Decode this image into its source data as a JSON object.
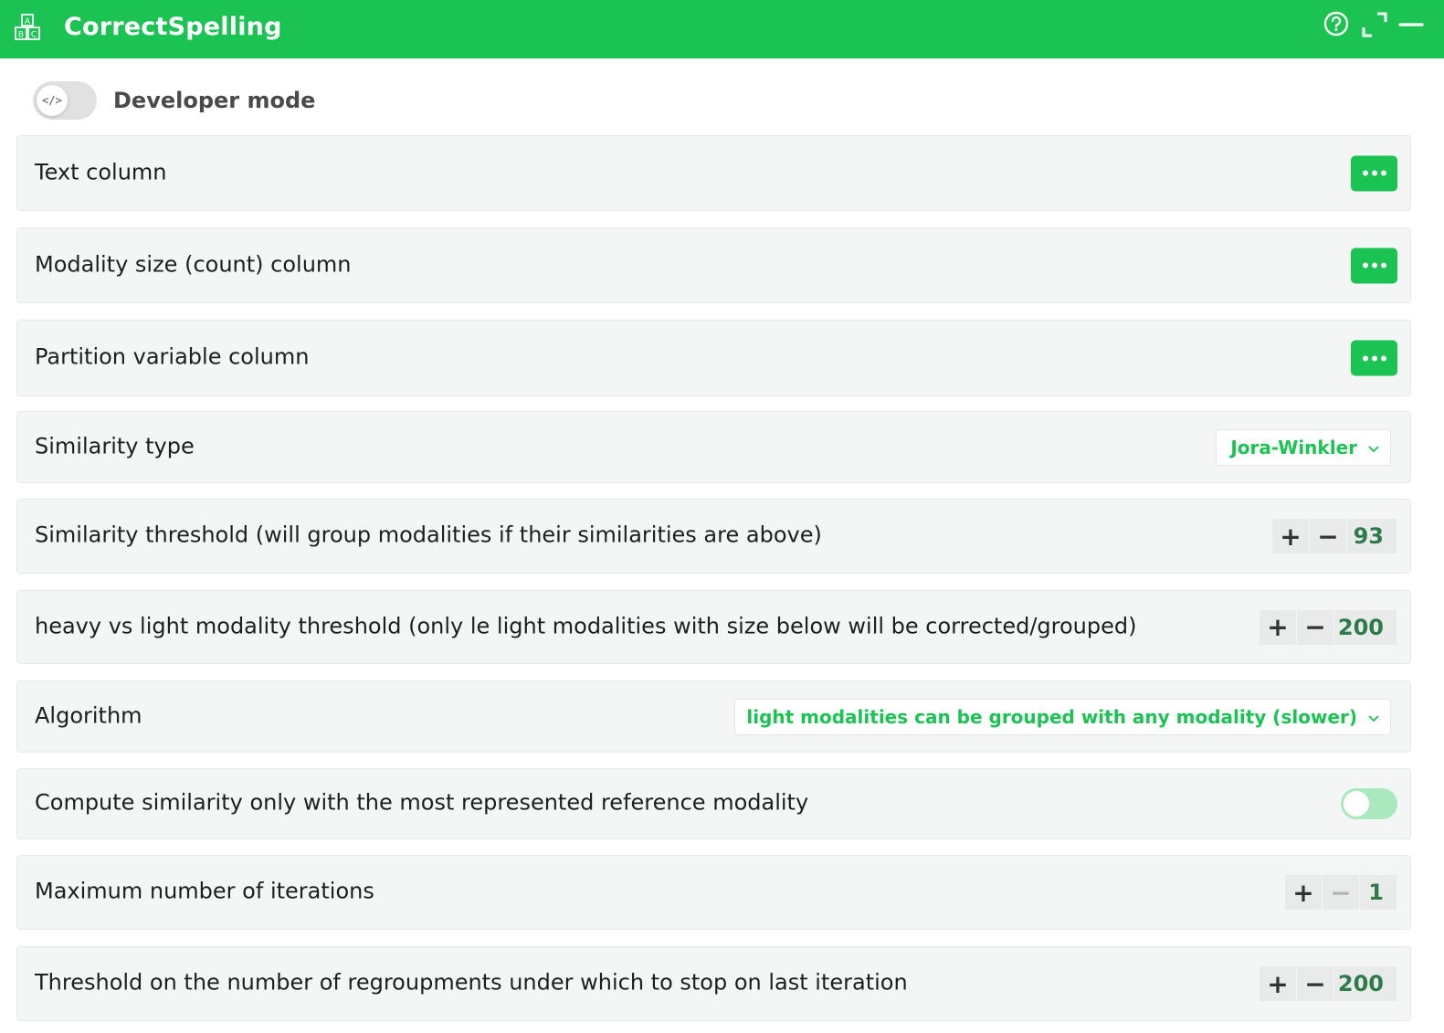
{
  "app": {
    "title": "CorrectSpelling",
    "icon": "abc-blocks-icon",
    "header_buttons": [
      "help-icon",
      "expand-icon",
      "minimize-icon"
    ],
    "accent_color": "#1bc353"
  },
  "developer_mode": {
    "label": "Developer mode",
    "toggle_icon_text": "</>",
    "enabled": false
  },
  "fields": {
    "text_column": {
      "label": "Text column",
      "action": "more-icon"
    },
    "modality_size_column": {
      "label": "Modality size (count) column",
      "action": "more-icon"
    },
    "partition_column": {
      "label": "Partition variable column",
      "action": "more-icon"
    },
    "similarity_type": {
      "label": "Similarity type",
      "selected": "Jora-Winkler"
    },
    "similarity_threshold": {
      "label": "Similarity threshold (will group modalities if their similarities are above)",
      "value": "93"
    },
    "heavy_light_threshold": {
      "label": "heavy vs light modality threshold (only le light modalities with size below will be corrected/grouped)",
      "value": "200"
    },
    "algorithm": {
      "label": "Algorithm",
      "selected": "light modalities can be grouped with any modality (slower)"
    },
    "most_represented_only": {
      "label": "Compute similarity only with the most represented reference modality",
      "enabled": false
    },
    "max_iterations": {
      "label": "Maximum number of iterations",
      "value": "1"
    },
    "regroupment_threshold": {
      "label": "Threshold on the number of regroupments under which to stop on last iteration",
      "value": "200"
    }
  },
  "stepper_symbols": {
    "plus": "+",
    "minus": "−"
  }
}
